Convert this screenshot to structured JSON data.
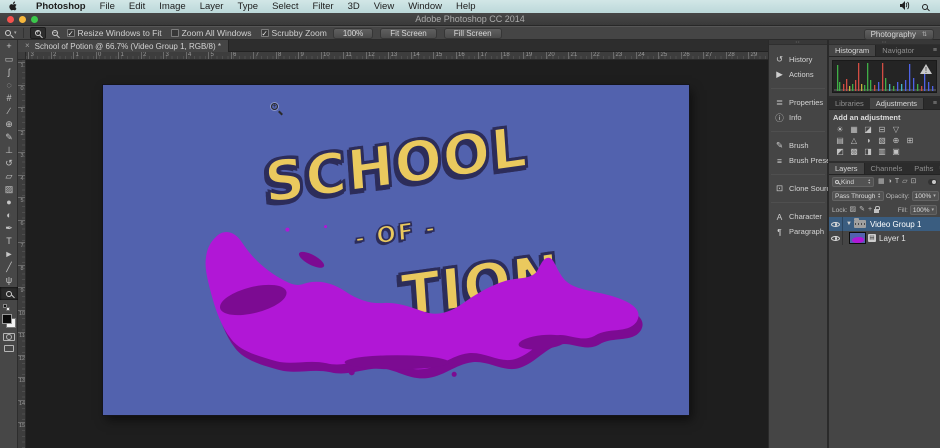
{
  "menu_bar": {
    "items": [
      "Photoshop",
      "File",
      "Edit",
      "Image",
      "Layer",
      "Type",
      "Select",
      "Filter",
      "3D",
      "View",
      "Window",
      "Help"
    ]
  },
  "title_bar": {
    "title": "Adobe Photoshop CC 2014"
  },
  "options_bar": {
    "active_tool": "zoom-tool",
    "checkboxes": [
      {
        "label": "Resize Windows to Fit",
        "checked": true
      },
      {
        "label": "Zoom All Windows",
        "checked": false
      },
      {
        "label": "Scrubby Zoom",
        "checked": true
      }
    ],
    "buttons": [
      "100%",
      "Fit Screen",
      "Fill Screen"
    ],
    "workspace": "Photography"
  },
  "toolbar": {
    "tools": [
      {
        "id": "move-tool",
        "glyph": "+"
      },
      {
        "id": "marquee-tool",
        "glyph": "▭"
      },
      {
        "id": "lasso-tool",
        "glyph": "ʃ"
      },
      {
        "id": "quick-selection-tool",
        "glyph": "◌"
      },
      {
        "id": "crop-tool",
        "glyph": "#"
      },
      {
        "id": "eyedropper-tool",
        "glyph": "∕"
      },
      {
        "id": "healing-brush-tool",
        "glyph": "⊕"
      },
      {
        "id": "brush-tool",
        "glyph": "✎"
      },
      {
        "id": "clone-stamp-tool",
        "glyph": "⊥"
      },
      {
        "id": "history-brush-tool",
        "glyph": "↺"
      },
      {
        "id": "eraser-tool",
        "glyph": "▱"
      },
      {
        "id": "gradient-tool",
        "glyph": "▨"
      },
      {
        "id": "blur-tool",
        "glyph": "●"
      },
      {
        "id": "dodge-tool",
        "glyph": "◐"
      },
      {
        "id": "pen-tool",
        "glyph": "✒"
      },
      {
        "id": "type-tool",
        "glyph": "T"
      },
      {
        "id": "path-selection-tool",
        "glyph": "►"
      },
      {
        "id": "line-tool",
        "glyph": "╱"
      },
      {
        "id": "hand-tool",
        "glyph": "ψ"
      },
      {
        "id": "zoom-tool",
        "glyph": "",
        "selected": true
      }
    ]
  },
  "document": {
    "tab_title": "School of Potion @ 66.7% (Video Group 1, RGB/8) *",
    "ruler_h": [
      "3",
      "2",
      "1",
      "0",
      "1",
      "2",
      "3",
      "4",
      "5",
      "6",
      "7",
      "8",
      "9",
      "10",
      "11",
      "12",
      "13",
      "14",
      "15",
      "16",
      "17",
      "18",
      "19",
      "20",
      "21",
      "22",
      "23",
      "24",
      "25",
      "26",
      "27",
      "28",
      "29"
    ],
    "ruler_v": [
      "1",
      "0",
      "1",
      "2",
      "3",
      "4",
      "5",
      "6",
      "7",
      "8",
      "9",
      "10",
      "11",
      "12",
      "13",
      "14",
      "15"
    ],
    "canvas": {
      "word1": "SCHOOL",
      "word2": "- OF -",
      "word3": "TION"
    }
  },
  "panel_buttons": [
    [
      {
        "id": "history",
        "icon": "↺",
        "label": "History"
      },
      {
        "id": "actions",
        "icon": "▶",
        "label": "Actions"
      }
    ],
    [
      {
        "id": "properties",
        "icon": "≣",
        "label": "Properties"
      },
      {
        "id": "info",
        "icon": "ⓘ",
        "label": "Info"
      }
    ],
    [
      {
        "id": "brush",
        "icon": "✎",
        "label": "Brush"
      },
      {
        "id": "brush-presets",
        "icon": "≡",
        "label": "Brush Prese..."
      }
    ],
    [
      {
        "id": "clone-source",
        "icon": "⊡",
        "label": "Clone Source"
      }
    ],
    [
      {
        "id": "character",
        "icon": "A",
        "label": "Character"
      },
      {
        "id": "paragraph",
        "icon": "¶",
        "label": "Paragraph"
      }
    ]
  ],
  "dock": {
    "histogram": {
      "tabs": [
        "Histogram",
        "Navigator"
      ],
      "active_tab": "Histogram",
      "spikes": [
        [
          4,
          26,
          "g"
        ],
        [
          6,
          9,
          "g"
        ],
        [
          10,
          7,
          "r"
        ],
        [
          13,
          12,
          "r"
        ],
        [
          16,
          5,
          "y"
        ],
        [
          19,
          7,
          "g"
        ],
        [
          22,
          11,
          "r"
        ],
        [
          25,
          28,
          "r"
        ],
        [
          28,
          7,
          "y"
        ],
        [
          31,
          6,
          "g"
        ],
        [
          34,
          28,
          "g"
        ],
        [
          37,
          11,
          "g"
        ],
        [
          41,
          6,
          "r"
        ],
        [
          45,
          9,
          "b"
        ],
        [
          49,
          28,
          "r"
        ],
        [
          52,
          13,
          "g"
        ],
        [
          56,
          7,
          "c"
        ],
        [
          60,
          5,
          "g"
        ],
        [
          64,
          9,
          "b"
        ],
        [
          68,
          7,
          "c"
        ],
        [
          72,
          11,
          "b"
        ],
        [
          76,
          27,
          "b"
        ],
        [
          80,
          13,
          "b"
        ],
        [
          84,
          7,
          "g"
        ],
        [
          88,
          5,
          "r"
        ],
        [
          91,
          22,
          "b"
        ],
        [
          95,
          9,
          "b"
        ],
        [
          99,
          5,
          "b"
        ]
      ]
    },
    "adjustments": {
      "tabs": [
        "Libraries",
        "Adjustments"
      ],
      "active_tab": "Adjustments",
      "heading": "Add an adjustment",
      "rows": [
        [
          {
            "id": "brightness-contrast",
            "glyph": "☀"
          },
          {
            "id": "levels",
            "glyph": "▦"
          },
          {
            "id": "curves",
            "glyph": "◪"
          },
          {
            "id": "exposure",
            "glyph": "⊟"
          },
          {
            "id": "vibrance",
            "glyph": "▽"
          }
        ],
        [
          {
            "id": "hue-saturation",
            "glyph": "▤"
          },
          {
            "id": "color-balance",
            "glyph": "△"
          },
          {
            "id": "black-white",
            "glyph": "◑"
          },
          {
            "id": "photo-filter",
            "glyph": "▧"
          },
          {
            "id": "channel-mixer",
            "glyph": "⊕"
          },
          {
            "id": "color-lookup",
            "glyph": "⊞"
          }
        ],
        [
          {
            "id": "invert",
            "glyph": "◩"
          },
          {
            "id": "posterize",
            "glyph": "▩"
          },
          {
            "id": "threshold",
            "glyph": "◨"
          },
          {
            "id": "gradient-map",
            "glyph": "▥"
          },
          {
            "id": "selective-color",
            "glyph": "▣"
          }
        ]
      ]
    },
    "layers": {
      "tabs": [
        "Layers",
        "Channels",
        "Paths"
      ],
      "active_tab": "Layers",
      "filter": {
        "kind_label": "Kind",
        "icons": [
          {
            "id": "filter-pixel-layers",
            "glyph": "▦"
          },
          {
            "id": "filter-adjustment-layers",
            "glyph": "◑"
          },
          {
            "id": "filter-type-layers",
            "glyph": "T"
          },
          {
            "id": "filter-shape-layers",
            "glyph": "▱"
          },
          {
            "id": "filter-smart-objects",
            "glyph": "⊡"
          }
        ]
      },
      "blend_mode": "Pass Through",
      "opacity_label": "Opacity:",
      "opacity_value": "100%",
      "lock_label": "Lock:",
      "lock_icons": [
        {
          "id": "lock-transparent-pixels",
          "glyph": "▨"
        },
        {
          "id": "lock-image-pixels",
          "glyph": "✎"
        },
        {
          "id": "lock-position",
          "glyph": "+"
        }
      ],
      "fill_label": "Fill:",
      "fill_value": "100%",
      "rows": [
        {
          "name": "Video Group 1",
          "type": "group",
          "selected": true
        },
        {
          "name": "Layer 1",
          "type": "video-layer",
          "selected": false
        }
      ]
    }
  },
  "colors": {
    "menubar_bg": "#c8dfe0",
    "ui_bg": "#454545",
    "pasteboard": "#1e1e1e",
    "canvas_bg": "#5262ae",
    "title_yellow": "#eac95e",
    "title_outline": "#2d2d5a",
    "splat_magenta": "#b117d6",
    "splat_shadow": "#7c0b92",
    "selected_layer": "#3a5d80"
  }
}
